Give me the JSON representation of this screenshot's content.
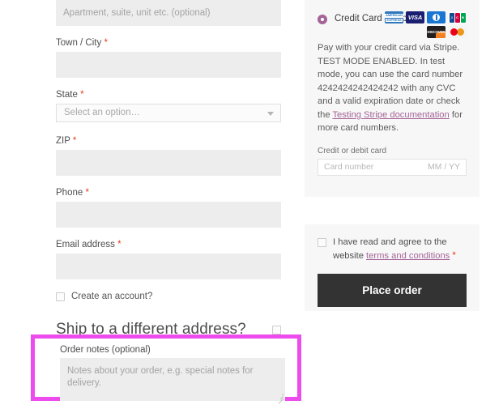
{
  "billing": {
    "apartment": {
      "placeholder": "Apartment, suite, unit etc. (optional)",
      "value": ""
    },
    "town": {
      "label": "Town / City",
      "required": "*",
      "value": ""
    },
    "state": {
      "label": "State",
      "required": "*",
      "value": "Select an option…"
    },
    "zip": {
      "label": "ZIP",
      "required": "*",
      "value": ""
    },
    "phone": {
      "label": "Phone",
      "required": "*",
      "value": ""
    },
    "email": {
      "label": "Email address",
      "required": "*",
      "value": ""
    },
    "create_account_label": "Create an account?",
    "ship_different_title": "Ship to a different address?"
  },
  "order_notes": {
    "label": "Order notes (optional)",
    "placeholder": "Notes about your order, e.g. special notes for delivery.",
    "value": "",
    "highlight_color": "#ed4bee"
  },
  "payment": {
    "method_label": "Credit Card (Stripe)",
    "accent_color": "#a46497",
    "cards": [
      {
        "name": "amex-card-icon",
        "label": "AMERICAN",
        "label2": "EXPRESS"
      },
      {
        "name": "visa-card-icon",
        "label": "VISA"
      },
      {
        "name": "diners-club-card-icon",
        "label": ""
      },
      {
        "name": "jcb-card-icon",
        "label": "JCB"
      },
      {
        "name": "discover-card-icon",
        "label": "DISCOVER"
      },
      {
        "name": "mastercard-card-icon",
        "label": ""
      }
    ],
    "description_part1": "Pay with your credit card via Stripe. TEST MODE ENABLED. In test mode, you can use the card number 4242424242424242 with any CVC and a valid expiration date or check the ",
    "description_link": "Testing Stripe documentation",
    "description_part2": " for more card numbers.",
    "card_field_label": "Credit or debit card",
    "card_number_placeholder": "Card number",
    "card_expiry_placeholder": "MM / YY"
  },
  "terms": {
    "text_before_link": "I have read and agree to the website ",
    "link_text": "terms and conditions",
    "required": "*",
    "place_order_label": "Place order"
  }
}
